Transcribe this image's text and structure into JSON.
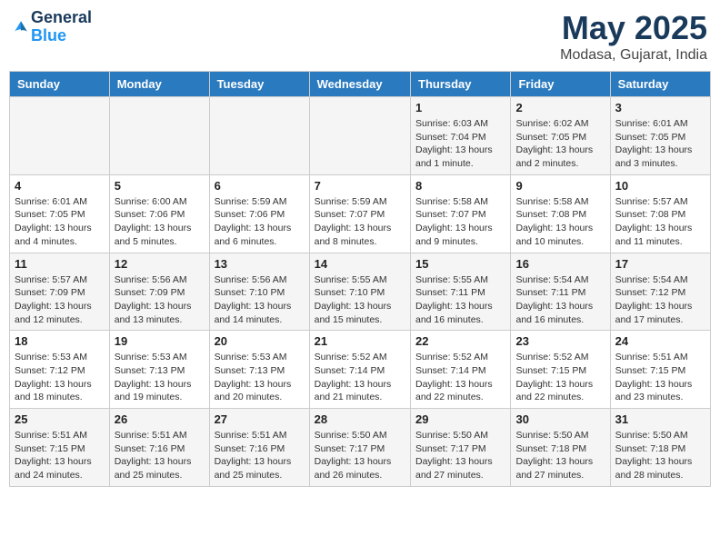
{
  "header": {
    "logo_line1": "General",
    "logo_line2": "Blue",
    "month": "May 2025",
    "location": "Modasa, Gujarat, India"
  },
  "weekdays": [
    "Sunday",
    "Monday",
    "Tuesday",
    "Wednesday",
    "Thursday",
    "Friday",
    "Saturday"
  ],
  "weeks": [
    [
      {
        "day": "",
        "info": ""
      },
      {
        "day": "",
        "info": ""
      },
      {
        "day": "",
        "info": ""
      },
      {
        "day": "",
        "info": ""
      },
      {
        "day": "1",
        "info": "Sunrise: 6:03 AM\nSunset: 7:04 PM\nDaylight: 13 hours\nand 1 minute."
      },
      {
        "day": "2",
        "info": "Sunrise: 6:02 AM\nSunset: 7:05 PM\nDaylight: 13 hours\nand 2 minutes."
      },
      {
        "day": "3",
        "info": "Sunrise: 6:01 AM\nSunset: 7:05 PM\nDaylight: 13 hours\nand 3 minutes."
      }
    ],
    [
      {
        "day": "4",
        "info": "Sunrise: 6:01 AM\nSunset: 7:05 PM\nDaylight: 13 hours\nand 4 minutes."
      },
      {
        "day": "5",
        "info": "Sunrise: 6:00 AM\nSunset: 7:06 PM\nDaylight: 13 hours\nand 5 minutes."
      },
      {
        "day": "6",
        "info": "Sunrise: 5:59 AM\nSunset: 7:06 PM\nDaylight: 13 hours\nand 6 minutes."
      },
      {
        "day": "7",
        "info": "Sunrise: 5:59 AM\nSunset: 7:07 PM\nDaylight: 13 hours\nand 8 minutes."
      },
      {
        "day": "8",
        "info": "Sunrise: 5:58 AM\nSunset: 7:07 PM\nDaylight: 13 hours\nand 9 minutes."
      },
      {
        "day": "9",
        "info": "Sunrise: 5:58 AM\nSunset: 7:08 PM\nDaylight: 13 hours\nand 10 minutes."
      },
      {
        "day": "10",
        "info": "Sunrise: 5:57 AM\nSunset: 7:08 PM\nDaylight: 13 hours\nand 11 minutes."
      }
    ],
    [
      {
        "day": "11",
        "info": "Sunrise: 5:57 AM\nSunset: 7:09 PM\nDaylight: 13 hours\nand 12 minutes."
      },
      {
        "day": "12",
        "info": "Sunrise: 5:56 AM\nSunset: 7:09 PM\nDaylight: 13 hours\nand 13 minutes."
      },
      {
        "day": "13",
        "info": "Sunrise: 5:56 AM\nSunset: 7:10 PM\nDaylight: 13 hours\nand 14 minutes."
      },
      {
        "day": "14",
        "info": "Sunrise: 5:55 AM\nSunset: 7:10 PM\nDaylight: 13 hours\nand 15 minutes."
      },
      {
        "day": "15",
        "info": "Sunrise: 5:55 AM\nSunset: 7:11 PM\nDaylight: 13 hours\nand 16 minutes."
      },
      {
        "day": "16",
        "info": "Sunrise: 5:54 AM\nSunset: 7:11 PM\nDaylight: 13 hours\nand 16 minutes."
      },
      {
        "day": "17",
        "info": "Sunrise: 5:54 AM\nSunset: 7:12 PM\nDaylight: 13 hours\nand 17 minutes."
      }
    ],
    [
      {
        "day": "18",
        "info": "Sunrise: 5:53 AM\nSunset: 7:12 PM\nDaylight: 13 hours\nand 18 minutes."
      },
      {
        "day": "19",
        "info": "Sunrise: 5:53 AM\nSunset: 7:13 PM\nDaylight: 13 hours\nand 19 minutes."
      },
      {
        "day": "20",
        "info": "Sunrise: 5:53 AM\nSunset: 7:13 PM\nDaylight: 13 hours\nand 20 minutes."
      },
      {
        "day": "21",
        "info": "Sunrise: 5:52 AM\nSunset: 7:14 PM\nDaylight: 13 hours\nand 21 minutes."
      },
      {
        "day": "22",
        "info": "Sunrise: 5:52 AM\nSunset: 7:14 PM\nDaylight: 13 hours\nand 22 minutes."
      },
      {
        "day": "23",
        "info": "Sunrise: 5:52 AM\nSunset: 7:15 PM\nDaylight: 13 hours\nand 22 minutes."
      },
      {
        "day": "24",
        "info": "Sunrise: 5:51 AM\nSunset: 7:15 PM\nDaylight: 13 hours\nand 23 minutes."
      }
    ],
    [
      {
        "day": "25",
        "info": "Sunrise: 5:51 AM\nSunset: 7:15 PM\nDaylight: 13 hours\nand 24 minutes."
      },
      {
        "day": "26",
        "info": "Sunrise: 5:51 AM\nSunset: 7:16 PM\nDaylight: 13 hours\nand 25 minutes."
      },
      {
        "day": "27",
        "info": "Sunrise: 5:51 AM\nSunset: 7:16 PM\nDaylight: 13 hours\nand 25 minutes."
      },
      {
        "day": "28",
        "info": "Sunrise: 5:50 AM\nSunset: 7:17 PM\nDaylight: 13 hours\nand 26 minutes."
      },
      {
        "day": "29",
        "info": "Sunrise: 5:50 AM\nSunset: 7:17 PM\nDaylight: 13 hours\nand 27 minutes."
      },
      {
        "day": "30",
        "info": "Sunrise: 5:50 AM\nSunset: 7:18 PM\nDaylight: 13 hours\nand 27 minutes."
      },
      {
        "day": "31",
        "info": "Sunrise: 5:50 AM\nSunset: 7:18 PM\nDaylight: 13 hours\nand 28 minutes."
      }
    ]
  ]
}
